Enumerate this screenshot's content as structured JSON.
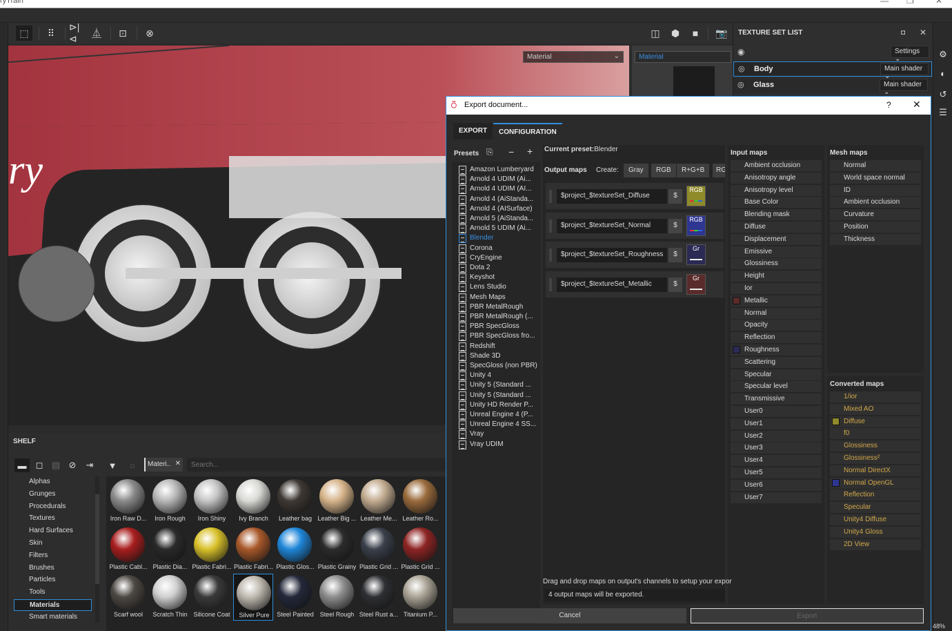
{
  "window": {
    "title": "ryTrain"
  },
  "viewport_toolbar": {
    "left_icons": [
      "select-frame-icon",
      "grid-icon",
      "mirror-x-icon",
      "mirror-y-icon",
      "fit-frame-icon",
      "reset-camera-icon"
    ],
    "right_icons": [
      "split-view-icon",
      "cube-view-icon",
      "camera-icon",
      "screenshot-icon"
    ]
  },
  "viewport": {
    "material_dropdown": "Material",
    "secondary_material_label": "Material",
    "logo_text": "ry"
  },
  "texture_set_list": {
    "title": "TEXTURE SET LIST",
    "settings_label": "Settings",
    "sets": [
      {
        "name": "Body",
        "shader": "Main shader",
        "selected": true
      },
      {
        "name": "Glass",
        "shader": "Main shader",
        "selected": false
      }
    ]
  },
  "right_bar": {
    "icons": [
      "display-settings-icon",
      "shader-settings-icon",
      "history-icon",
      "log-icon"
    ]
  },
  "shelf": {
    "title": "SHELF",
    "filter_chip": "Materi..",
    "search_placeholder": "Search...",
    "categories": [
      {
        "label": "Alphas"
      },
      {
        "label": "Grunges"
      },
      {
        "label": "Procedurals"
      },
      {
        "label": "Textures"
      },
      {
        "label": "Hard Surfaces"
      },
      {
        "label": "Skin"
      },
      {
        "label": "Filters"
      },
      {
        "label": "Brushes"
      },
      {
        "label": "Particles"
      },
      {
        "label": "Tools"
      },
      {
        "label": "Materials",
        "selected": true
      },
      {
        "label": "Smart materials"
      }
    ],
    "materials": [
      {
        "label": "Iron Raw D...",
        "color": "#8a8a8a"
      },
      {
        "label": "Iron Rough",
        "color": "#b7b7b7"
      },
      {
        "label": "Iron Shiny",
        "color": "#c4c4c4"
      },
      {
        "label": "Ivy Branch",
        "color": "#d8d8d4"
      },
      {
        "label": "Leather bag",
        "color": "#3e3833"
      },
      {
        "label": "Leather Big ...",
        "color": "#d6b48a"
      },
      {
        "label": "Leather Me...",
        "color": "#c2ab90"
      },
      {
        "label": "Leather Ro...",
        "color": "#9a6b3c"
      },
      {
        "label": "Plastic Cabl...",
        "color": "#a81e1e"
      },
      {
        "label": "Plastic Dia...",
        "color": "#2a2a2a"
      },
      {
        "label": "Plastic Fabri...",
        "color": "#d8c12a"
      },
      {
        "label": "Plastic Fabri...",
        "color": "#a8582a"
      },
      {
        "label": "Plastic Glos...",
        "color": "#1f86d8"
      },
      {
        "label": "Plastic Grainy",
        "color": "#2b2b2b"
      },
      {
        "label": "Plastic Grid ...",
        "color": "#3a3f4a"
      },
      {
        "label": "Plastic Grid ...",
        "color": "#8e2424"
      },
      {
        "label": "Scarf wool",
        "color": "#4d4843"
      },
      {
        "label": "Scratch Thin",
        "color": "#cfd0cf"
      },
      {
        "label": "Silicone Coat",
        "color": "#3a3a3a"
      },
      {
        "label": "Silver Pure",
        "color": "#bdb7ad",
        "selected": true
      },
      {
        "label": "Steel Painted",
        "color": "#23283a"
      },
      {
        "label": "Steel Rough",
        "color": "#8d8d8d"
      },
      {
        "label": "Steel Rust a...",
        "color": "#2e2f33"
      },
      {
        "label": "Titanium P...",
        "color": "#a9a294"
      }
    ]
  },
  "export_dialog": {
    "title": "Export document...",
    "help": "?",
    "tabs": [
      {
        "label": "EXPORT"
      },
      {
        "label": "CONFIGURATION",
        "active": true
      }
    ],
    "presets_label": "Presets",
    "presets": [
      "Amazon Lumberyard",
      "Arnold 4  UDIM (Ai...",
      "Arnold 4  UDIM (AI...",
      "Arnold 4 (AiStanda...",
      "Arnold 4 (AISurface)",
      "Arnold 5 (AiStanda...",
      "Arnold 5 UDIM (Ai...",
      "Blender",
      "Corona",
      "CryEngine",
      "Dota 2",
      "Keyshot",
      "Lens Studio",
      "Mesh Maps",
      "PBR MetalRough",
      "PBR MetalRough (...",
      "PBR SpecGloss",
      "PBR SpecGloss fro...",
      "Redshift",
      "Shade 3D",
      "SpecGloss (non PBR)",
      "Unity 4",
      "Unity 5 (Standard ...",
      "Unity 5 (Standard ...",
      "Unity HD Render P...",
      "Unreal Engine 4 (P...",
      "Unreal Engine 4 SS...",
      "Vray",
      "Vray UDIM"
    ],
    "selected_preset": "Blender",
    "current_preset_label": "Current preset:",
    "current_preset_value": "Blender",
    "output_maps_label": "Output maps",
    "create_label": "Create:",
    "create_buttons": [
      "Gray",
      "RGB",
      "R+G+B",
      "RG"
    ],
    "output_maps": [
      {
        "name": "$project_$textureSet_Diffuse",
        "dollar": "$",
        "channel": "RGB",
        "color": "#8f8a2a"
      },
      {
        "name": "$project_$textureSet_Normal",
        "dollar": "$",
        "channel": "RGB",
        "color": "#2e3691"
      },
      {
        "name": "$project_$textureSet_Roughness",
        "dollar": "$",
        "channel": "Gr",
        "color": "#2b2a55"
      },
      {
        "name": "$project_$textureSet_Metallic",
        "dollar": "$",
        "channel": "Gr",
        "color": "#5a2b2b"
      }
    ],
    "input_maps_label": "Input maps",
    "input_maps": [
      {
        "label": "Ambient occlusion"
      },
      {
        "label": "Anisotropy angle"
      },
      {
        "label": "Anisotropy level"
      },
      {
        "label": "Base Color"
      },
      {
        "label": "Blending mask"
      },
      {
        "label": "Diffuse"
      },
      {
        "label": "Displacement"
      },
      {
        "label": "Emissive"
      },
      {
        "label": "Glossiness"
      },
      {
        "label": "Height"
      },
      {
        "label": "Ior"
      },
      {
        "label": "Metallic",
        "swatch": "#5a2b2b"
      },
      {
        "label": "Normal"
      },
      {
        "label": "Opacity"
      },
      {
        "label": "Reflection"
      },
      {
        "label": "Roughness",
        "swatch": "#2b2a55"
      },
      {
        "label": "Scattering"
      },
      {
        "label": "Specular"
      },
      {
        "label": "Specular level"
      },
      {
        "label": "Transmissive"
      },
      {
        "label": "User0"
      },
      {
        "label": "User1"
      },
      {
        "label": "User2"
      },
      {
        "label": "User3"
      },
      {
        "label": "User4"
      },
      {
        "label": "User5"
      },
      {
        "label": "User6"
      },
      {
        "label": "User7"
      }
    ],
    "mesh_maps_label": "Mesh maps",
    "mesh_maps": [
      "Normal",
      "World space normal",
      "ID",
      "Ambient occlusion",
      "Curvature",
      "Position",
      "Thickness"
    ],
    "converted_maps_label": "Converted maps",
    "converted_maps": [
      {
        "label": "1/ior"
      },
      {
        "label": "Mixed AO"
      },
      {
        "label": "Diffuse",
        "swatch": "#8f8a2a"
      },
      {
        "label": "f0"
      },
      {
        "label": "Glossiness"
      },
      {
        "label": "Glossiness²"
      },
      {
        "label": "Normal DirectX"
      },
      {
        "label": "Normal OpenGL",
        "swatch": "#2e3691"
      },
      {
        "label": "Reflection"
      },
      {
        "label": "Specular"
      },
      {
        "label": "Unity4 Diffuse"
      },
      {
        "label": "Unity4 Gloss"
      },
      {
        "label": "2D View"
      }
    ],
    "hint": "Drag and drop maps on output's channels to setup your expor",
    "status": "4 output maps will be exported.",
    "cancel_label": "Cancel",
    "export_label": "Export"
  },
  "status": {
    "zoom": "48%"
  },
  "colors": {
    "accent": "#2f8fdd",
    "converted_text": "#d2a94a"
  }
}
